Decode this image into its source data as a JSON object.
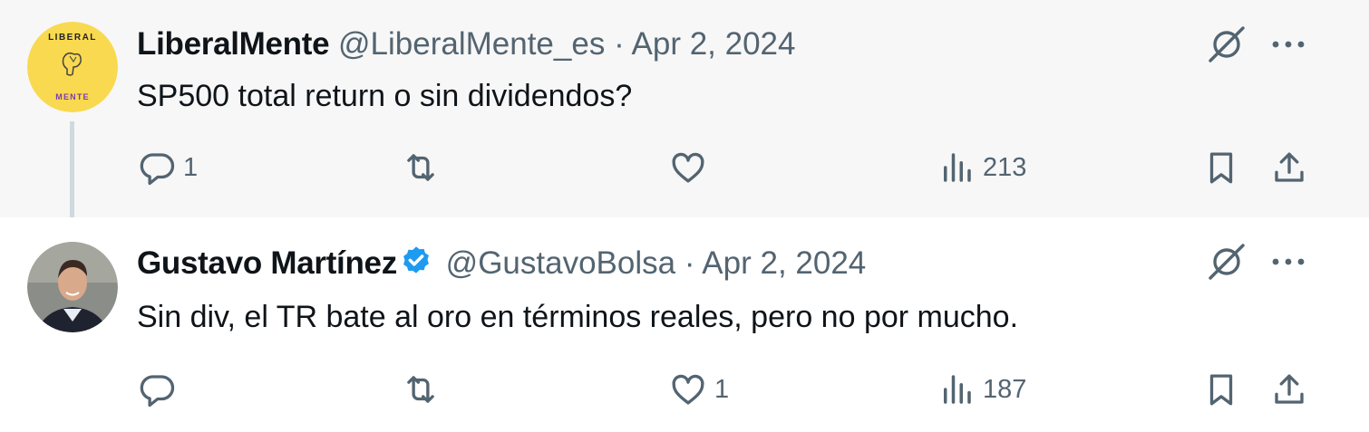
{
  "tweets": [
    {
      "author": "LiberalMente",
      "handle": "@LiberalMente_es",
      "separator": "·",
      "date": "Apr 2, 2024",
      "verified": false,
      "text": "SP500 total return o sin dividendos?",
      "avatar": {
        "top_text": "LIBERAL",
        "bottom_text": "MENTE",
        "bg_color": "#f9d94f"
      },
      "counts": {
        "replies": "1",
        "reposts": "",
        "likes": "",
        "views": "213"
      }
    },
    {
      "author": "Gustavo Martínez",
      "handle": "@GustavoBolsa",
      "separator": "·",
      "date": "Apr 2, 2024",
      "verified": true,
      "text": "Sin div, el TR bate al oro en términos reales, pero no por mucho.",
      "avatar": {
        "bg_color": "#8a8d88"
      },
      "counts": {
        "replies": "",
        "reposts": "",
        "likes": "1",
        "views": "187"
      }
    }
  ],
  "colors": {
    "muted": "#536471",
    "verified_blue": "#1d9bf0",
    "thread_line": "#cfd9de",
    "highlight_bg": "#f7f7f7"
  }
}
